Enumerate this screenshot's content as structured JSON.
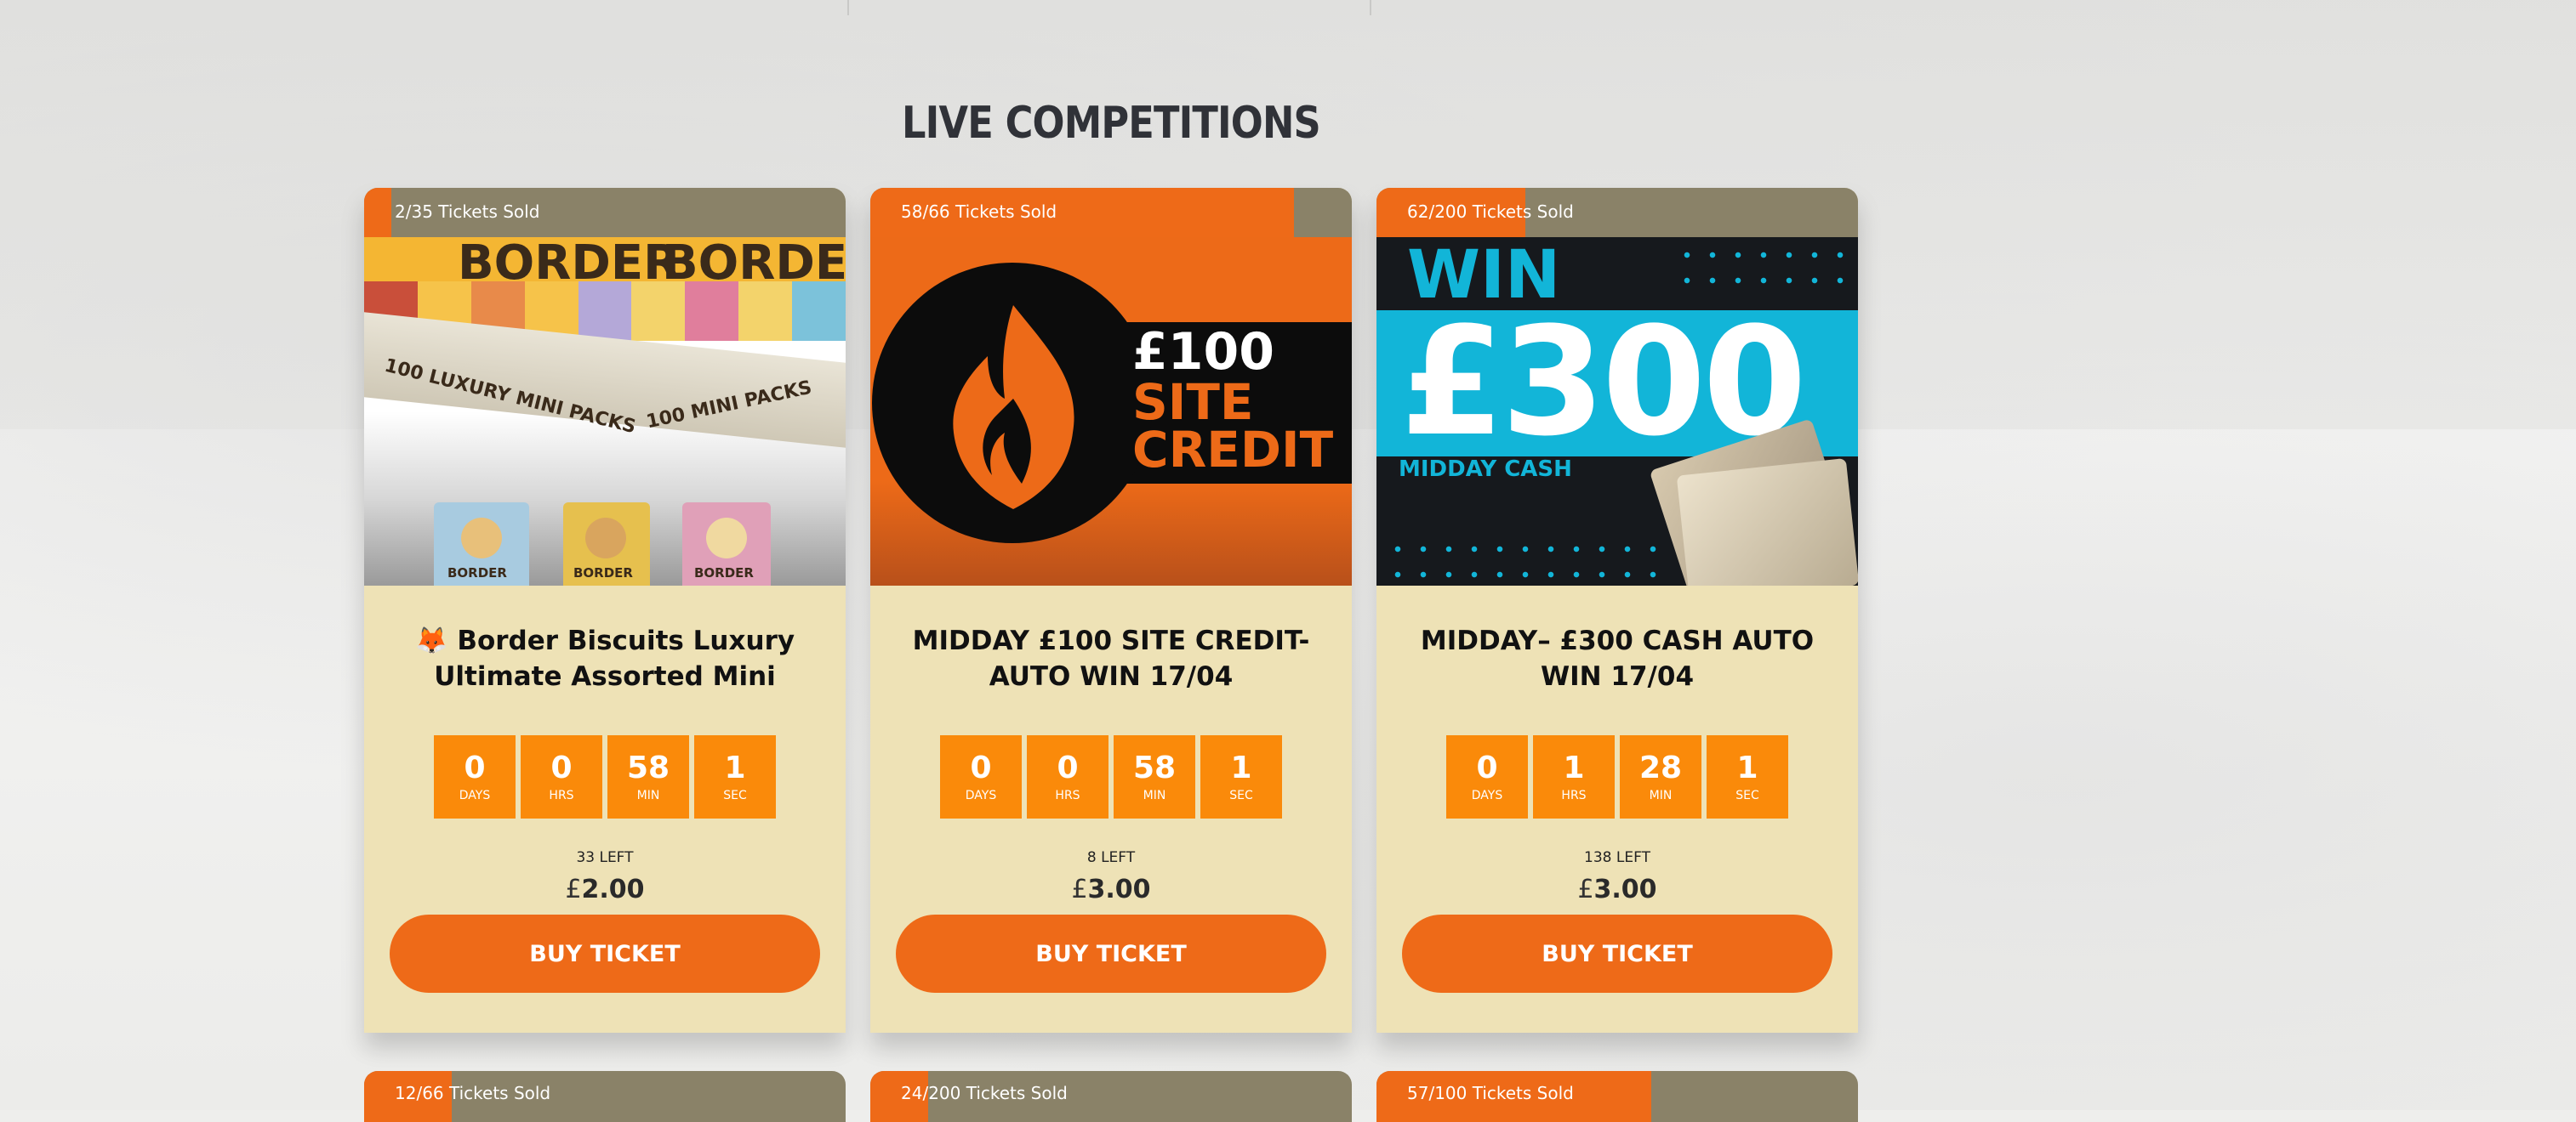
{
  "section": {
    "title": "LIVE COMPETITIONS"
  },
  "colors": {
    "accent": "#ee6a18",
    "countdown": "#fa8a0a",
    "card_bg": "#eee2b6",
    "bar_bg": "#8a8268"
  },
  "cards": [
    {
      "sold_text": "2/35 Tickets Sold",
      "sold_fraction": 0.057,
      "title": "🦊 Border Biscuits Luxury Ultimate Assorted Mini Pack...",
      "image": {
        "brand": "BORDER",
        "box_text_a": "100 LUXURY MINI PACKS",
        "box_text_b": "100 MINI PACKS",
        "pack_label": "BORDER"
      },
      "countdown": [
        {
          "value": "0",
          "label": "DAYS"
        },
        {
          "value": "0",
          "label": "HRS"
        },
        {
          "value": "58",
          "label": "MIN"
        },
        {
          "value": "1",
          "label": "SEC"
        }
      ],
      "left_text": "33 LEFT",
      "currency": "£",
      "price": "2.00",
      "button": "BUY TICKET"
    },
    {
      "sold_text": "58/66 Tickets Sold",
      "sold_fraction": 0.879,
      "title": "MIDDAY £100 SITE CREDIT- AUTO WIN 17/04",
      "image": {
        "line1": "£100",
        "line2": "SITE",
        "line3": "CREDIT"
      },
      "countdown": [
        {
          "value": "0",
          "label": "DAYS"
        },
        {
          "value": "0",
          "label": "HRS"
        },
        {
          "value": "58",
          "label": "MIN"
        },
        {
          "value": "1",
          "label": "SEC"
        }
      ],
      "left_text": "8 LEFT",
      "currency": "£",
      "price": "3.00",
      "button": "BUY TICKET"
    },
    {
      "sold_text": "62/200 Tickets Sold",
      "sold_fraction": 0.31,
      "title": "MIDDAY– £300 CASH AUTO WIN 17/04",
      "image": {
        "line1": "WIN",
        "line2": "£300",
        "line3": "MIDDAY CASH"
      },
      "countdown": [
        {
          "value": "0",
          "label": "DAYS"
        },
        {
          "value": "1",
          "label": "HRS"
        },
        {
          "value": "28",
          "label": "MIN"
        },
        {
          "value": "1",
          "label": "SEC"
        }
      ],
      "left_text": "138 LEFT",
      "currency": "£",
      "price": "3.00",
      "button": "BUY TICKET"
    }
  ],
  "next_cards": [
    {
      "sold_text": "12/66 Tickets Sold",
      "sold_fraction": 0.182
    },
    {
      "sold_text": "24/200 Tickets Sold",
      "sold_fraction": 0.12
    },
    {
      "sold_text": "57/100 Tickets Sold",
      "sold_fraction": 0.57
    }
  ]
}
